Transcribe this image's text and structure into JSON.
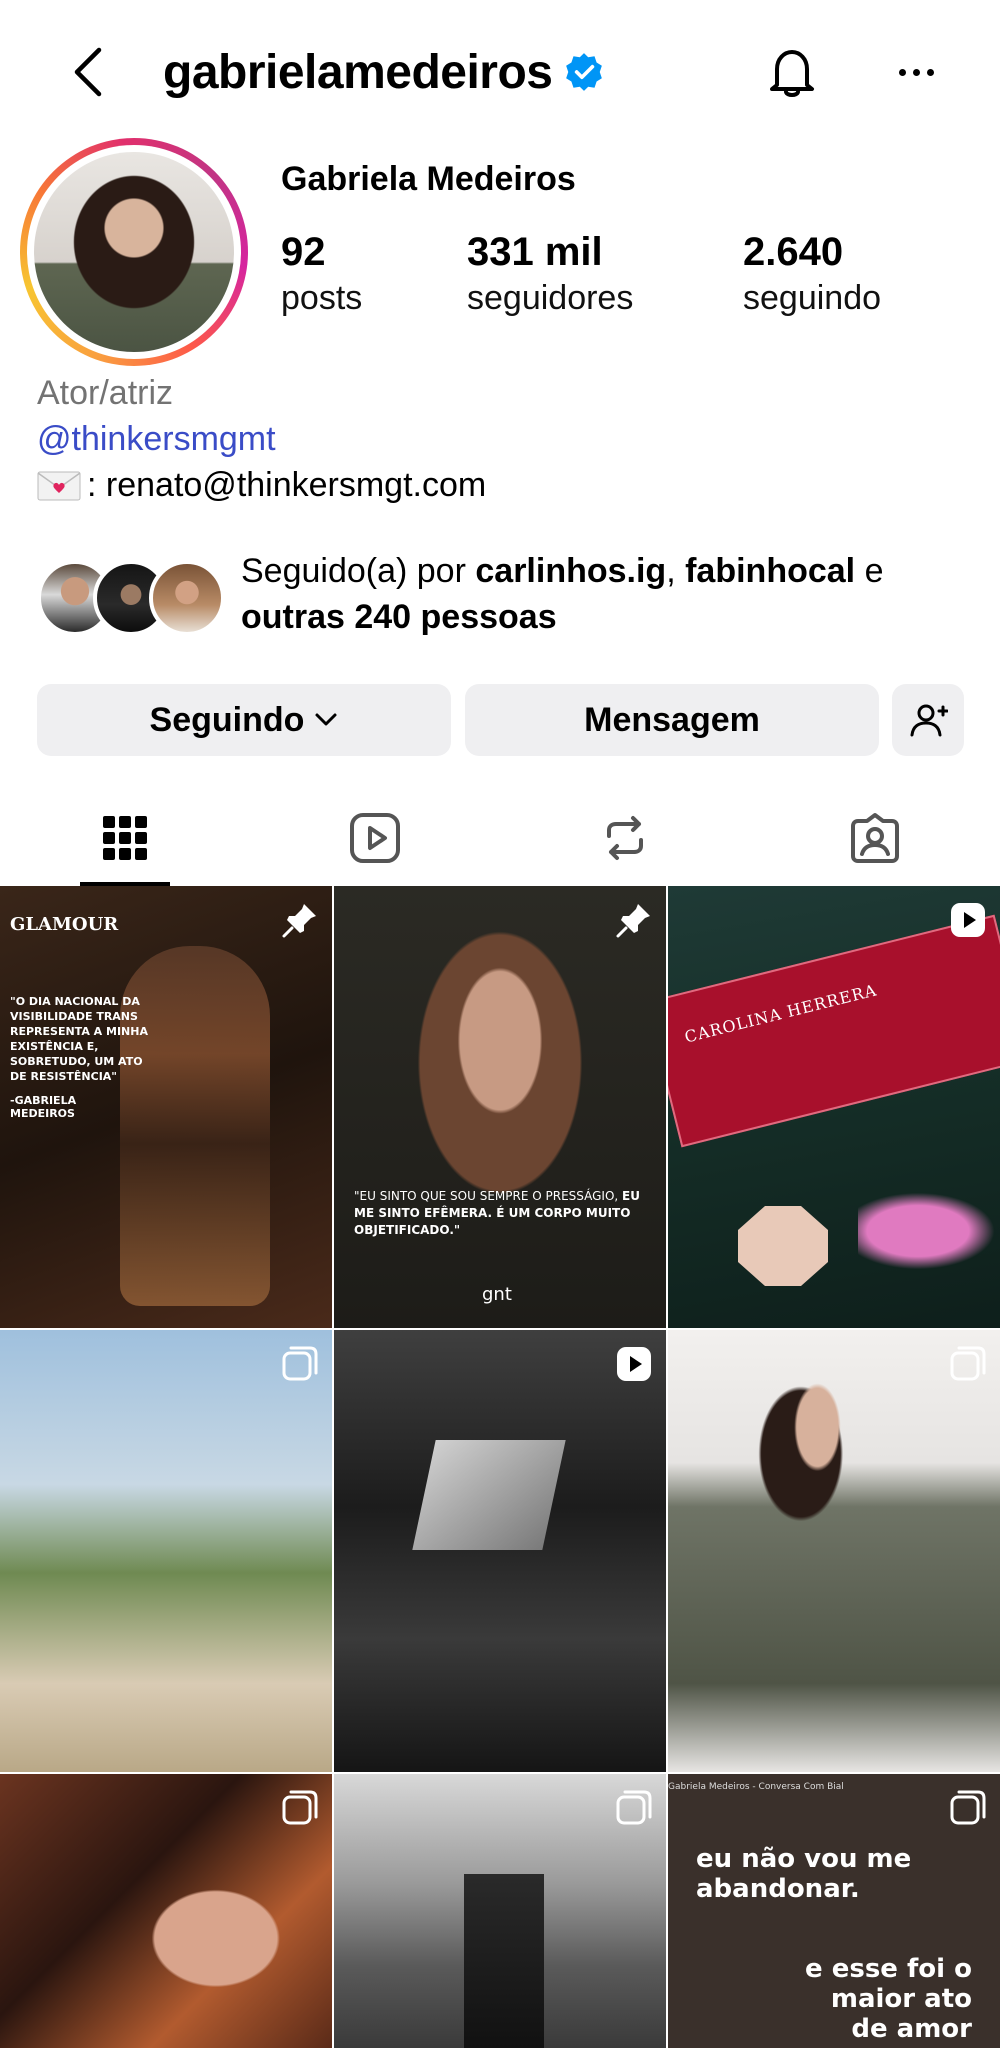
{
  "header": {
    "username": "gabrielamedeiros",
    "verified": true
  },
  "profile": {
    "display_name": "Gabriela Medeiros",
    "stats": [
      {
        "value": "92",
        "label": "posts"
      },
      {
        "value": "331 mil",
        "label": "seguidores"
      },
      {
        "value": "2.640",
        "label": "seguindo"
      }
    ],
    "category": "Ator/atriz",
    "link": "@thinkersmgmt",
    "contact": ": renato@thinkersmgt.com",
    "followed_by": {
      "prefix": "Seguido(a) por ",
      "user1": "carlinhos.ig",
      "sep": ", ",
      "user2": "fabinhocal",
      "conj": " e ",
      "others": "outras 240 pessoas"
    }
  },
  "actions": {
    "following_label": "Seguindo",
    "message_label": "Mensagem"
  },
  "tabs": [
    {
      "icon": "grid-icon",
      "active": true
    },
    {
      "icon": "reels-icon",
      "active": false
    },
    {
      "icon": "reposts-icon",
      "active": false
    },
    {
      "icon": "tagged-icon",
      "active": false
    }
  ],
  "posts": [
    {
      "badge": "pin-icon",
      "brand": "GLAMOUR",
      "quote": "\"O DIA NACIONAL DA VISIBILIDADE TRANS REPRESENTA A MINHA EXISTÊNCIA E, SOBRETUDO, UM ATO DE RESISTÊNCIA\"",
      "author": "-GABRIELA MEDEIROS"
    },
    {
      "badge": "pin-icon",
      "quote_a": "\"EU SINTO QUE SOU SEMPRE O PRESSÁGIO, ",
      "quote_b": "EU ME SINTO EFÊMERA. É UM CORPO MUITO OBJETIFICADO.\"",
      "brand": "gnt"
    },
    {
      "badge": "reel-icon",
      "text": "CAROLINA HERRERA"
    },
    {
      "badge": "carousel-icon"
    },
    {
      "badge": "reel-icon"
    },
    {
      "badge": "carousel-icon"
    },
    {
      "badge": "carousel-icon"
    },
    {
      "badge": "carousel-icon"
    },
    {
      "badge": "carousel-icon",
      "caption_top": "eu não vou me abandonar.",
      "caption_bottom": "e esse foi o maior ato de amor",
      "ticker": "Gabriela Medeiros - Conversa Com Bial"
    }
  ],
  "colors": {
    "link": "#3a4cc7",
    "verified": "#0095f6",
    "button_bg": "#efeff1"
  }
}
